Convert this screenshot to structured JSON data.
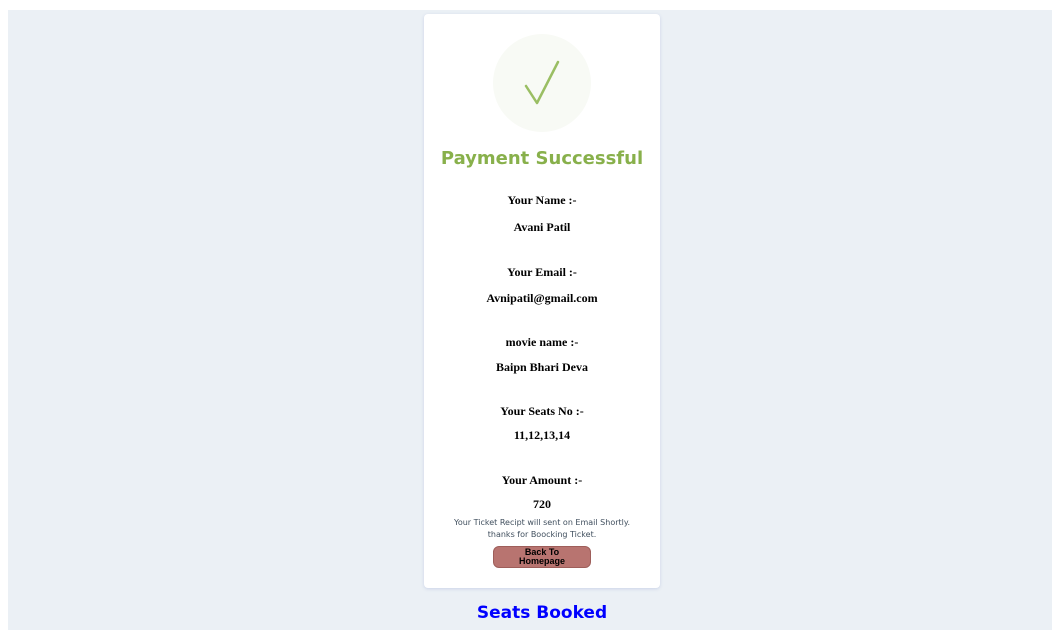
{
  "status": {
    "title": "Payment Successful",
    "icon": "checkmark-icon",
    "accent_color": "#88b04b"
  },
  "details": {
    "name_label": "Your Name :-",
    "name_value": "Avani Patil",
    "email_label": "Your Email :-",
    "email_value": "Avnipatil@gmail.com",
    "movie_label": "movie name :-",
    "movie_value": "Baipn Bhari Deva",
    "seats_label": "Your Seats No :-",
    "seats_value": "11,12,13,14",
    "amount_label": "Your Amount :-",
    "amount_value": "720"
  },
  "footer": {
    "note_line1": "Your Ticket Recipt will sent on Email Shortly.",
    "note_line2": "thanks for Boocking Ticket.",
    "back_button_label": "Back To Homepage"
  },
  "section": {
    "seats_booked_title": "Seats Booked"
  }
}
